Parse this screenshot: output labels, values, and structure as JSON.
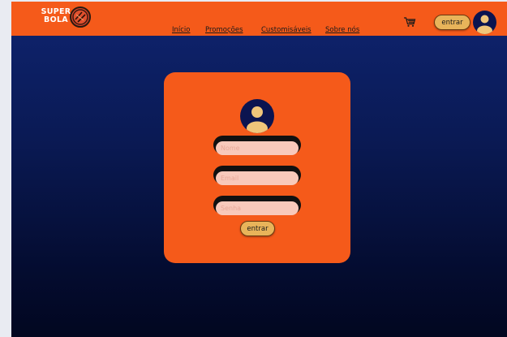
{
  "header": {
    "logo_line1": "SUPER",
    "logo_line2": "BOLA",
    "nav": [
      {
        "label": "Início"
      },
      {
        "label": "Promoções"
      },
      {
        "label": "Customisáveis"
      },
      {
        "label": "Sobre nós"
      }
    ],
    "cart_icon": "shopping-cart-icon",
    "login_label": "entrar",
    "avatar_icon": "user-avatar-icon"
  },
  "form": {
    "avatar_icon": "user-avatar-icon",
    "name_placeholder": "Nome",
    "email_placeholder": "Email",
    "password_placeholder": "Senha",
    "submit_label": "entrar"
  },
  "colors": {
    "accent_orange": "#f55a1a",
    "button_gold": "#e8b45a",
    "navy": "#0b1450",
    "background_top": "#0f2470",
    "background_bottom": "#020720"
  }
}
